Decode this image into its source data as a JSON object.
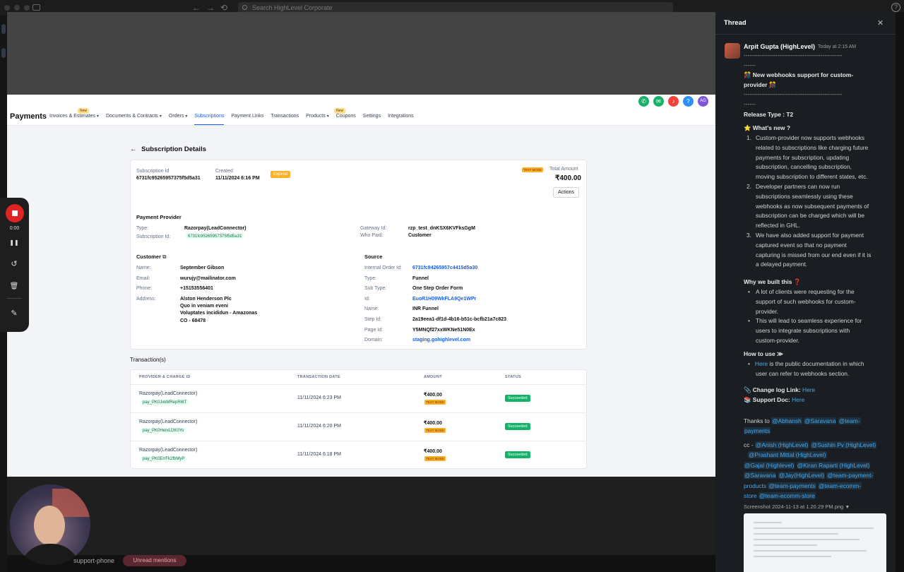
{
  "browser": {
    "search_placeholder": "Search HighLevel Corporate",
    "back_icon": "←",
    "forward_icon": "→",
    "history_icon": "⟲",
    "help_icon": "?"
  },
  "app": {
    "brand": "Payments",
    "tabs": [
      {
        "label": "Invoices & Estimates",
        "badge": "New",
        "chevron": true,
        "active": false
      },
      {
        "label": "Documents & Contracts",
        "badge": "",
        "chevron": true,
        "active": false
      },
      {
        "label": "Orders",
        "badge": "",
        "chevron": true,
        "active": false
      },
      {
        "label": "Subscriptions",
        "badge": "",
        "chevron": false,
        "active": true
      },
      {
        "label": "Payment Links",
        "badge": "",
        "chevron": false,
        "active": false
      },
      {
        "label": "Transactions",
        "badge": "",
        "chevron": false,
        "active": false
      },
      {
        "label": "Products",
        "badge": "New",
        "chevron": true,
        "active": false
      },
      {
        "label": "Coupons",
        "badge": "",
        "chevron": false,
        "active": false
      },
      {
        "label": "Settings",
        "badge": "",
        "chevron": false,
        "active": false
      },
      {
        "label": "Integrations",
        "badge": "",
        "chevron": false,
        "active": false
      }
    ],
    "header_icons": [
      {
        "name": "phone-icon",
        "glyph": "✆",
        "color": "#17b26a"
      },
      {
        "name": "megaphone-icon",
        "glyph": "✉",
        "color": "#17b26a"
      },
      {
        "name": "bell-icon",
        "glyph": "♪",
        "color": "#f04438"
      },
      {
        "name": "help-icon",
        "glyph": "?",
        "color": "#2e90fa"
      },
      {
        "name": "user-avatar-icon",
        "glyph": "AG",
        "color": "#7f56d9"
      }
    ],
    "page_title": "Subscription Details",
    "back_arrow": "←",
    "summary": {
      "sub_id_label": "Subscription Id",
      "sub_id": "6731fc95265957375f5d5a31",
      "created_label": "Created",
      "created": "11/11/2024 6:16 PM",
      "status": "Expired",
      "test_mode": "TEST MODE",
      "total_label": "Total Amount",
      "total": "₹400.00",
      "actions": "Actions"
    },
    "provider": {
      "title": "Payment Provider",
      "type_label": "Type:",
      "type": "Razorpay(LeadConnector)",
      "sub_label": "Subscription Id:",
      "sub_id": "6731fc95265957375f5d5a31",
      "gateway_label": "Gateway Id:",
      "gateway": "rzp_test_dnKSX6KVFksGgM",
      "who_paid_label": "Who Paid:",
      "who_paid": "Customer"
    },
    "customer": {
      "title": "Customer",
      "name_label": "Name:",
      "name": "September Gibson",
      "email_label": "Email:",
      "email": "wurujy@mailinator.com",
      "phone_label": "Phone:",
      "phone": "+15153556401",
      "address_label": "Address:",
      "address": [
        "Alston Henderson Plc",
        "Quo in veniam eveni",
        "Voluptates incididun - Amazonas",
        "CO - 68478"
      ]
    },
    "source": {
      "title": "Source",
      "rows": [
        {
          "label": "Internal Order Id:",
          "value": "6731fc94265957c4415d5a30",
          "link": true
        },
        {
          "label": "Type:",
          "value": "Funnel",
          "link": false
        },
        {
          "label": "Sub Type:",
          "value": "One Step Order Form",
          "link": false
        },
        {
          "label": "Id:",
          "value": "EuoR1H09WkFLA9Qe1WPr",
          "link": true
        },
        {
          "label": "Name:",
          "value": "INR Funnel",
          "link": false
        },
        {
          "label": "Step Id:",
          "value": "2a19eea1-df1d-4b16-b51c-bcfb21a7c823",
          "link": false
        },
        {
          "label": "Page Id:",
          "value": "Y5MNQf27xxWKNe51N0Ex",
          "link": false
        },
        {
          "label": "Domain:",
          "value": "staging.gohighlevel.com",
          "link": true
        }
      ]
    },
    "transactions": {
      "title": "Transaction(s)",
      "headers": [
        "PROVIDER & CHARGE ID",
        "TRANSACTION DATE",
        "AMOUNT",
        "STATUS"
      ],
      "rows": [
        {
          "provider": "Razorpay(LeadConnector)",
          "charge": "pay_PK0JxkMRepR6tT",
          "date": "11/11/2024 6:23 PM",
          "amount": "₹400.00",
          "mode": "TEST MODE",
          "status": "Succeeded"
        },
        {
          "provider": "Razorpay(LeadConnector)",
          "charge": "pay_PK0HeIxLDK0Yo",
          "date": "11/11/2024 6:20 PM",
          "amount": "₹400.00",
          "mode": "TEST MODE",
          "status": "Succeeded"
        },
        {
          "provider": "Razorpay(LeadConnector)",
          "charge": "pay_PK0ErrFk2fbMyP",
          "date": "11/11/2024 6:18 PM",
          "amount": "₹400.00",
          "mode": "TEST MODE",
          "status": "Succeeded"
        }
      ]
    }
  },
  "recorder": {
    "time": "0:00",
    "pause_icon": "❚❚",
    "restart_icon": "↺",
    "trash_icon": "🗑",
    "pen_icon": "✎"
  },
  "bottom": {
    "channel": "support-phone",
    "pill": "Unread mentions"
  },
  "thread": {
    "title": "Thread",
    "close_icon": "✕",
    "author": "Arpit Gupta (HighLevel)",
    "time": "Today at 2:15 AM",
    "dashes1": "--------------------------------------------------",
    "dashes1b": "------",
    "headline": "🎊 New webhooks support for custom-",
    "headline2": "provider 🎊",
    "dashes2": "--------------------------------------------------",
    "dashes2b": "------",
    "release": "Release Type : T2",
    "whats_new": "⭐ What's new ?",
    "items": [
      [
        "Custom-provider now supports webhooks",
        "related to subscriptions like charging future",
        "payments for subscription, updating",
        "subscription, cancelling subscription,",
        "moving subscription to different states, etc."
      ],
      [
        "Developer partners can now run",
        "subscriptions seamlessly using these",
        "webhooks as now subsequent payments of",
        "subscription can be charged which will be",
        "reflected in GHL."
      ],
      [
        "We have also added support for payment",
        "captured event so that no payment",
        "capturing is missed from our end even if it is",
        "a delayed payment."
      ]
    ],
    "why": "Why we built this ❓",
    "why_items": [
      [
        "A lot of clients were requesting for the",
        "support of such webhooks for custom-",
        "provider."
      ],
      [
        "This will lead to seamless experience for",
        "users to integrate subscriptions with",
        "custom-provider."
      ]
    ],
    "how": "How to use ≫",
    "how_link": "Here",
    "how_text": " is the public documentation in which",
    "how_text2": "user can refer to webhooks section.",
    "changelog": "📎 Change log Link: ",
    "changelog_link": "Here",
    "support": "📚 Support Doc: ",
    "support_link": "Here",
    "thanks": "Thanks to ",
    "thanks_mentions": [
      "@Abhansh",
      "@Saravana",
      "@team-",
      "payments"
    ],
    "cc_prefix": "cc - ",
    "cc_lines": [
      [
        "@Anish (HighLevel)",
        "@Sushin Pv (HighLevel)"
      ],
      [
        "@Prashant Mittal (HighLevel)"
      ],
      [
        "@Gajal (Highlevel)",
        "@Kiran Raparti (HighLevel)"
      ],
      [
        "@Saravana",
        "@Jay(HighLevel)",
        "@team-payment-"
      ],
      [
        "products",
        "@team-payments",
        "@team-ecomm-"
      ],
      [
        "store",
        "@team-ecomm-store"
      ]
    ],
    "attachment": "Screenshot 2024-11-13 at 1.20.29 PM.png",
    "attachment_caret": "▼"
  }
}
